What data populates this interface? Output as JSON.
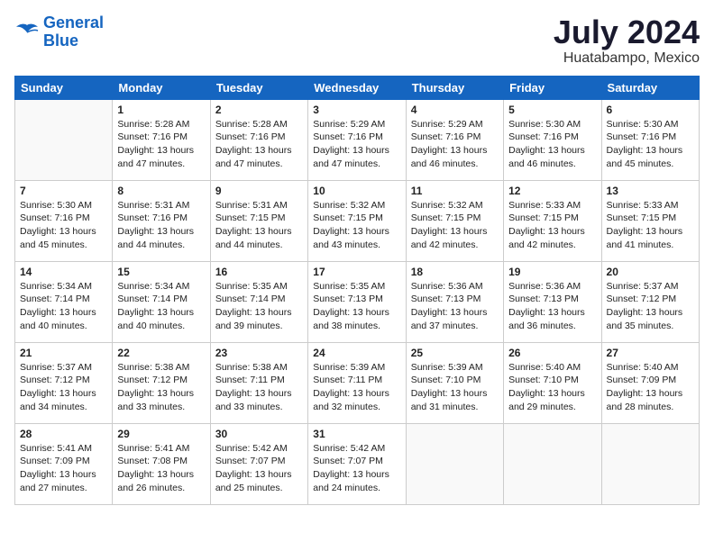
{
  "header": {
    "logo_line1": "General",
    "logo_line2": "Blue",
    "month": "July 2024",
    "location": "Huatabampo, Mexico"
  },
  "weekdays": [
    "Sunday",
    "Monday",
    "Tuesday",
    "Wednesday",
    "Thursday",
    "Friday",
    "Saturday"
  ],
  "weeks": [
    [
      {
        "day": "",
        "info": ""
      },
      {
        "day": "1",
        "info": "Sunrise: 5:28 AM\nSunset: 7:16 PM\nDaylight: 13 hours\nand 47 minutes."
      },
      {
        "day": "2",
        "info": "Sunrise: 5:28 AM\nSunset: 7:16 PM\nDaylight: 13 hours\nand 47 minutes."
      },
      {
        "day": "3",
        "info": "Sunrise: 5:29 AM\nSunset: 7:16 PM\nDaylight: 13 hours\nand 47 minutes."
      },
      {
        "day": "4",
        "info": "Sunrise: 5:29 AM\nSunset: 7:16 PM\nDaylight: 13 hours\nand 46 minutes."
      },
      {
        "day": "5",
        "info": "Sunrise: 5:30 AM\nSunset: 7:16 PM\nDaylight: 13 hours\nand 46 minutes."
      },
      {
        "day": "6",
        "info": "Sunrise: 5:30 AM\nSunset: 7:16 PM\nDaylight: 13 hours\nand 45 minutes."
      }
    ],
    [
      {
        "day": "7",
        "info": "Sunrise: 5:30 AM\nSunset: 7:16 PM\nDaylight: 13 hours\nand 45 minutes."
      },
      {
        "day": "8",
        "info": "Sunrise: 5:31 AM\nSunset: 7:16 PM\nDaylight: 13 hours\nand 44 minutes."
      },
      {
        "day": "9",
        "info": "Sunrise: 5:31 AM\nSunset: 7:15 PM\nDaylight: 13 hours\nand 44 minutes."
      },
      {
        "day": "10",
        "info": "Sunrise: 5:32 AM\nSunset: 7:15 PM\nDaylight: 13 hours\nand 43 minutes."
      },
      {
        "day": "11",
        "info": "Sunrise: 5:32 AM\nSunset: 7:15 PM\nDaylight: 13 hours\nand 42 minutes."
      },
      {
        "day": "12",
        "info": "Sunrise: 5:33 AM\nSunset: 7:15 PM\nDaylight: 13 hours\nand 42 minutes."
      },
      {
        "day": "13",
        "info": "Sunrise: 5:33 AM\nSunset: 7:15 PM\nDaylight: 13 hours\nand 41 minutes."
      }
    ],
    [
      {
        "day": "14",
        "info": "Sunrise: 5:34 AM\nSunset: 7:14 PM\nDaylight: 13 hours\nand 40 minutes."
      },
      {
        "day": "15",
        "info": "Sunrise: 5:34 AM\nSunset: 7:14 PM\nDaylight: 13 hours\nand 40 minutes."
      },
      {
        "day": "16",
        "info": "Sunrise: 5:35 AM\nSunset: 7:14 PM\nDaylight: 13 hours\nand 39 minutes."
      },
      {
        "day": "17",
        "info": "Sunrise: 5:35 AM\nSunset: 7:13 PM\nDaylight: 13 hours\nand 38 minutes."
      },
      {
        "day": "18",
        "info": "Sunrise: 5:36 AM\nSunset: 7:13 PM\nDaylight: 13 hours\nand 37 minutes."
      },
      {
        "day": "19",
        "info": "Sunrise: 5:36 AM\nSunset: 7:13 PM\nDaylight: 13 hours\nand 36 minutes."
      },
      {
        "day": "20",
        "info": "Sunrise: 5:37 AM\nSunset: 7:12 PM\nDaylight: 13 hours\nand 35 minutes."
      }
    ],
    [
      {
        "day": "21",
        "info": "Sunrise: 5:37 AM\nSunset: 7:12 PM\nDaylight: 13 hours\nand 34 minutes."
      },
      {
        "day": "22",
        "info": "Sunrise: 5:38 AM\nSunset: 7:12 PM\nDaylight: 13 hours\nand 33 minutes."
      },
      {
        "day": "23",
        "info": "Sunrise: 5:38 AM\nSunset: 7:11 PM\nDaylight: 13 hours\nand 33 minutes."
      },
      {
        "day": "24",
        "info": "Sunrise: 5:39 AM\nSunset: 7:11 PM\nDaylight: 13 hours\nand 32 minutes."
      },
      {
        "day": "25",
        "info": "Sunrise: 5:39 AM\nSunset: 7:10 PM\nDaylight: 13 hours\nand 31 minutes."
      },
      {
        "day": "26",
        "info": "Sunrise: 5:40 AM\nSunset: 7:10 PM\nDaylight: 13 hours\nand 29 minutes."
      },
      {
        "day": "27",
        "info": "Sunrise: 5:40 AM\nSunset: 7:09 PM\nDaylight: 13 hours\nand 28 minutes."
      }
    ],
    [
      {
        "day": "28",
        "info": "Sunrise: 5:41 AM\nSunset: 7:09 PM\nDaylight: 13 hours\nand 27 minutes."
      },
      {
        "day": "29",
        "info": "Sunrise: 5:41 AM\nSunset: 7:08 PM\nDaylight: 13 hours\nand 26 minutes."
      },
      {
        "day": "30",
        "info": "Sunrise: 5:42 AM\nSunset: 7:07 PM\nDaylight: 13 hours\nand 25 minutes."
      },
      {
        "day": "31",
        "info": "Sunrise: 5:42 AM\nSunset: 7:07 PM\nDaylight: 13 hours\nand 24 minutes."
      },
      {
        "day": "",
        "info": ""
      },
      {
        "day": "",
        "info": ""
      },
      {
        "day": "",
        "info": ""
      }
    ]
  ]
}
